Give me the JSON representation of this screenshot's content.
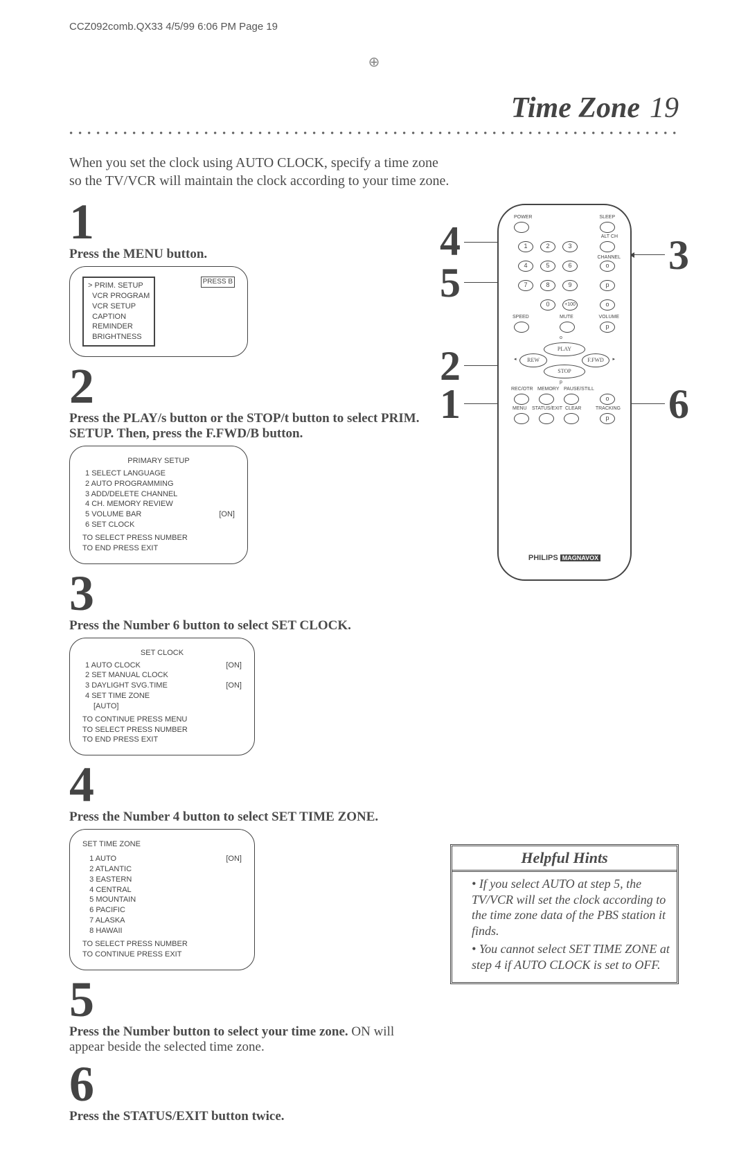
{
  "header": "CCZ092comb.QX33  4/5/99 6:06 PM  Page 19",
  "title": "Time Zone",
  "page_number": "19",
  "intro": "When you set the clock using AUTO CLOCK, specify a time zone so the TV/VCR will maintain the clock according to your time zone.",
  "steps": {
    "s1": {
      "num": "1",
      "label": "Press the MENU button."
    },
    "s2": {
      "num": "2",
      "label_a": "Press the PLAY/",
      "label_b": " button or the STOP/",
      "label_c": " button to select PRIM. SETUP.  Then, press the F.FWD/",
      "label_d": " button.",
      "sym_a": "s",
      "sym_b": "t",
      "sym_c": "B"
    },
    "s3": {
      "num": "3",
      "label": "Press the Number 6 button to select SET CLOCK."
    },
    "s4": {
      "num": "4",
      "label": "Press the Number 4 button to select SET TIME ZONE."
    },
    "s5": {
      "num": "5",
      "label_bold": "Press the Number button to select your time zone. ",
      "label_rest": "ON will appear beside the selected time zone."
    },
    "s6": {
      "num": "6",
      "label": "Press the STATUS/EXIT button twice."
    }
  },
  "screen1": {
    "badge": "PRESS B",
    "lines": [
      "PRIM. SETUP",
      "VCR PROGRAM",
      "VCR SETUP",
      "CAPTION",
      "REMINDER",
      "BRIGHTNESS"
    ]
  },
  "screen2": {
    "title": "PRIMARY SETUP",
    "items": [
      {
        "n": "1",
        "t": "SELECT LANGUAGE",
        "v": ""
      },
      {
        "n": "2",
        "t": "AUTO PROGRAMMING",
        "v": ""
      },
      {
        "n": "3",
        "t": "ADD/DELETE CHANNEL",
        "v": ""
      },
      {
        "n": "4",
        "t": "CH. MEMORY REVIEW",
        "v": ""
      },
      {
        "n": "5",
        "t": "VOLUME BAR",
        "v": "[ON]"
      },
      {
        "n": "6",
        "t": "SET CLOCK",
        "v": ""
      }
    ],
    "foot": [
      "TO SELECT PRESS NUMBER",
      "TO END PRESS EXIT"
    ]
  },
  "screen3": {
    "title": "SET CLOCK",
    "items": [
      {
        "n": "1",
        "t": "AUTO CLOCK",
        "v": "[ON]"
      },
      {
        "n": "2",
        "t": "SET MANUAL CLOCK",
        "v": ""
      },
      {
        "n": "3",
        "t": "DAYLIGHT SVG.TIME",
        "v": "[ON]"
      },
      {
        "n": "4",
        "t": "SET TIME ZONE",
        "v": ""
      }
    ],
    "extra": "[AUTO]",
    "foot": [
      "TO CONTINUE PRESS MENU",
      "TO SELECT PRESS NUMBER",
      "TO END PRESS EXIT"
    ]
  },
  "screen4": {
    "title": "SET TIME ZONE",
    "items": [
      {
        "n": "1",
        "t": "AUTO",
        "v": "[ON]"
      },
      {
        "n": "2",
        "t": "ATLANTIC",
        "v": ""
      },
      {
        "n": "3",
        "t": "EASTERN",
        "v": ""
      },
      {
        "n": "4",
        "t": "CENTRAL",
        "v": ""
      },
      {
        "n": "5",
        "t": "MOUNTAIN",
        "v": ""
      },
      {
        "n": "6",
        "t": "PACIFIC",
        "v": ""
      },
      {
        "n": "7",
        "t": "ALASKA",
        "v": ""
      },
      {
        "n": "8",
        "t": "HAWAII",
        "v": ""
      }
    ],
    "foot": [
      "TO SELECT PRESS NUMBER",
      "TO CONTINUE PRESS EXIT"
    ]
  },
  "remote": {
    "labels": {
      "power": "POWER",
      "sleep": "SLEEP",
      "altch": "ALT CH",
      "channel": "CHANNEL",
      "speed": "SPEED",
      "mute": "MUTE",
      "volume": "VOLUME",
      "play": "PLAY",
      "rew": "REW",
      "ffwd": "F.FWD",
      "stop": "STOP",
      "rec": "REC/OTR",
      "memory": "MEMORY",
      "pause": "PAUSE/STILL",
      "menu": "MENU",
      "status": "STATUS/EXIT",
      "clear": "CLEAR",
      "tracking": "TRACKING",
      "plus100": "+100"
    },
    "brand": "PHILIPS",
    "brand2": "MAGNAVOX"
  },
  "callouts": {
    "c4": "4",
    "c3": "3",
    "c5": "5",
    "c2": "2",
    "c1": "1",
    "c6": "6"
  },
  "hints": {
    "title": "Helpful Hints",
    "items": [
      "If you select AUTO at step 5, the TV/VCR will set the clock according to the time zone data of the PBS station it finds.",
      "You cannot select SET TIME ZONE at step 4 if AUTO CLOCK is set to OFF."
    ]
  }
}
